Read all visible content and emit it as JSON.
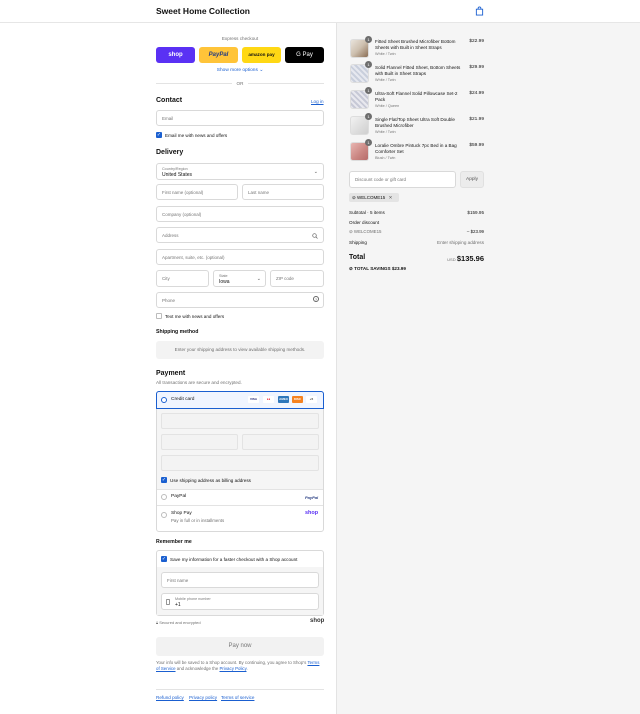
{
  "header": {
    "store_name": "Sweet Home Collection",
    "cart_icon": "shopping-bag-icon"
  },
  "express": {
    "label": "Express checkout",
    "buttons": [
      {
        "label": "shop",
        "color": "#5a31f4"
      },
      {
        "label": "PayPal",
        "color": "#ffc439"
      },
      {
        "label": "amazon pay",
        "color": "#ffd814"
      },
      {
        "label": "G Pay",
        "color": "#000000"
      }
    ],
    "more_options": "Show more options",
    "or": "OR"
  },
  "contact": {
    "title": "Contact",
    "login": "Log in",
    "email_placeholder": "Email",
    "email_news": "Email me with news and offers"
  },
  "delivery": {
    "title": "Delivery",
    "country_label": "Country/Region",
    "country_value": "United States",
    "first_name": "First name (optional)",
    "last_name": "Last name",
    "company": "Company (optional)",
    "address": "Address",
    "apartment": "Apartment, suite, etc. (optional)",
    "city": "City",
    "state_label": "State",
    "state_value": "Iowa",
    "zip": "ZIP code",
    "phone": "Phone",
    "text_news": "Text me with news and offers"
  },
  "shipping_method": {
    "title": "Shipping method",
    "note": "Enter your shipping address to view available shipping methods."
  },
  "payment": {
    "title": "Payment",
    "subtitle": "All transactions are secure and encrypted.",
    "credit_card": "Credit card",
    "card_brands": [
      "VISA",
      "MC",
      "AMEX",
      "DISC",
      "+5"
    ],
    "billing_same": "Use shipping address as billing address",
    "paypal": "PayPal",
    "paypal_logo": "PayPal",
    "shop_pay": "Shop Pay",
    "shop_pay_sub": "Pay in full or in installments",
    "shop_logo": "shop"
  },
  "remember": {
    "title": "Remember me",
    "save_info": "Save my information for a faster checkout with a Shop account",
    "first_name": "First name",
    "mobile_label": "Mobile phone number",
    "mobile_value": "+1",
    "secure": "Secured and encrypted",
    "shop_logo": "shop"
  },
  "pay_now": "Pay now",
  "legal": {
    "text1": "Your info will be saved to a Shop account. By continuing, you agree to Shop's",
    "terms": "Terms of Service",
    "text2": "and acknowledge the",
    "privacy": "Privacy Policy",
    "end": "."
  },
  "footer": {
    "links": [
      "Refund policy",
      "Privacy policy",
      "Terms of service"
    ]
  },
  "cart": {
    "items": [
      {
        "name": "Fitted Sheet Brushed Microfiber Bottom Sheets with Built in Sheet Straps",
        "variant": "White / Twin",
        "price": "$22.99",
        "qty": "1"
      },
      {
        "name": "Solid Flannel Fitted Sheet, Bottom Sheets with Built in Sheet Straps",
        "variant": "White / Twin",
        "price": "$29.99",
        "qty": "1"
      },
      {
        "name": "Ultra-Soft Flannel Solid Pillowcase Set-2 Pack",
        "variant": "White / Queen",
        "price": "$24.99",
        "qty": "1"
      },
      {
        "name": "Single Flat/Top Sheet Ultra Soft Double Brushed Microfiber",
        "variant": "White / Twin",
        "price": "$21.99",
        "qty": "1"
      },
      {
        "name": "Loralie Ombre Pintuck 7pc Bed in a Bag Comforter Set",
        "variant": "Blush / Twin",
        "price": "$59.99",
        "qty": "1"
      }
    ],
    "discount_placeholder": "Discount code or gift card",
    "apply": "Apply",
    "applied_code": "WELCOME15",
    "subtotal_label": "Subtotal · 5 items",
    "subtotal_value": "$159.95",
    "order_discount_label": "Order discount",
    "discount_code": "WELCOME15",
    "discount_value": "– $23.99",
    "shipping_label": "Shipping",
    "shipping_value": "Enter shipping address",
    "total_label": "Total",
    "currency": "USD",
    "total_value": "$135.96",
    "savings_label": "TOTAL SAVINGS",
    "savings_value": "$23.99"
  }
}
